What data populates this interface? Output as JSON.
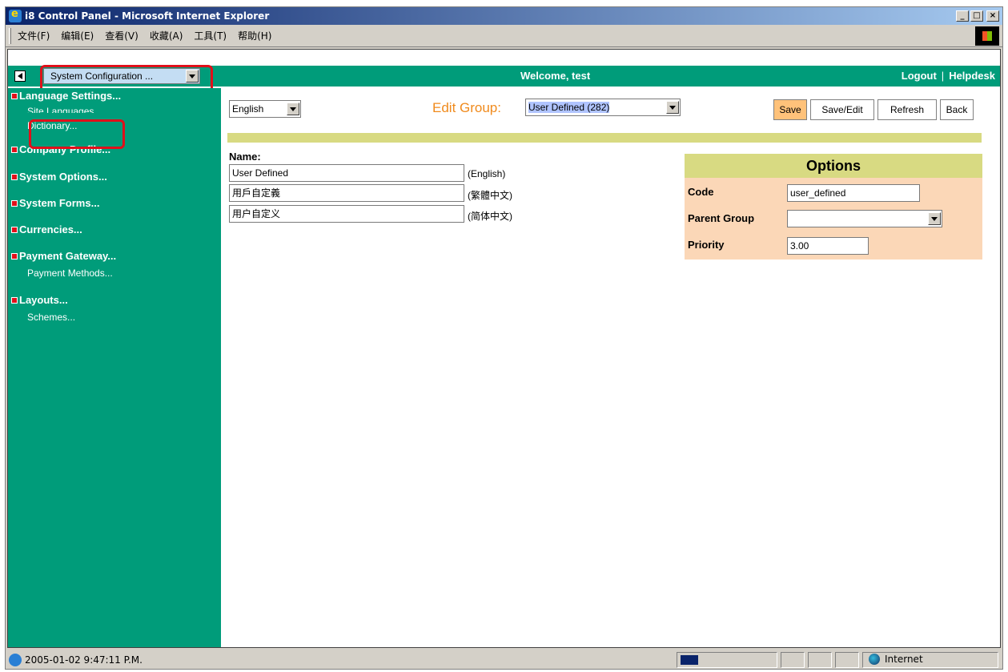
{
  "window": {
    "title": "i8 Control Panel - Microsoft Internet Explorer",
    "controls": [
      "_",
      "□",
      "×"
    ]
  },
  "menubar": {
    "items": [
      "文件(F)",
      "编辑(E)",
      "查看(V)",
      "收藏(A)",
      "工具(T)",
      "帮助(H)"
    ]
  },
  "topbar": {
    "section_select": "System Configuration ...",
    "welcome": "Welcome, test",
    "logout": "Logout",
    "separator": "|",
    "helpdesk": "Helpdesk"
  },
  "sidebar": {
    "sections": [
      {
        "title": "Language Settings...",
        "items": [
          "Site Languages",
          "Dictionary..."
        ]
      },
      {
        "title": "Company Profile...",
        "items": []
      },
      {
        "title": "System Options...",
        "items": []
      },
      {
        "title": "System Forms...",
        "items": []
      },
      {
        "title": "Currencies...",
        "items": []
      },
      {
        "title": "Payment Gateway...",
        "items": [
          "Payment Methods..."
        ]
      },
      {
        "title": "Layouts...",
        "items": [
          "Schemes..."
        ]
      }
    ]
  },
  "main": {
    "language_select": "English",
    "edit_group_label": "Edit Group:",
    "edit_group_select": "User Defined (282)",
    "buttons": {
      "save": "Save",
      "save_edit": "Save/Edit",
      "refresh": "Refresh",
      "back": "Back"
    },
    "name_label": "Name:",
    "names": [
      {
        "value": "User Defined",
        "lang": "(English)"
      },
      {
        "value": "用戶自定義",
        "lang": "(繁體中文)"
      },
      {
        "value": "用户自定义",
        "lang": "(简体中文)"
      }
    ],
    "options": {
      "title": "Options",
      "code_label": "Code",
      "code_value": "user_defined",
      "parent_label": "Parent Group",
      "parent_value": "",
      "priority_label": "Priority",
      "priority_value": "3.00"
    }
  },
  "statusbar": {
    "text": "2005-01-02 9:47:11 P.M.",
    "zone": "Internet"
  },
  "colors": {
    "sidebar_green": "#009c7a",
    "accent_orange": "#f08a1c",
    "highlight_red": "#e0101a",
    "options_bg": "#fbd7b7",
    "olive_bar": "#d8da82"
  }
}
